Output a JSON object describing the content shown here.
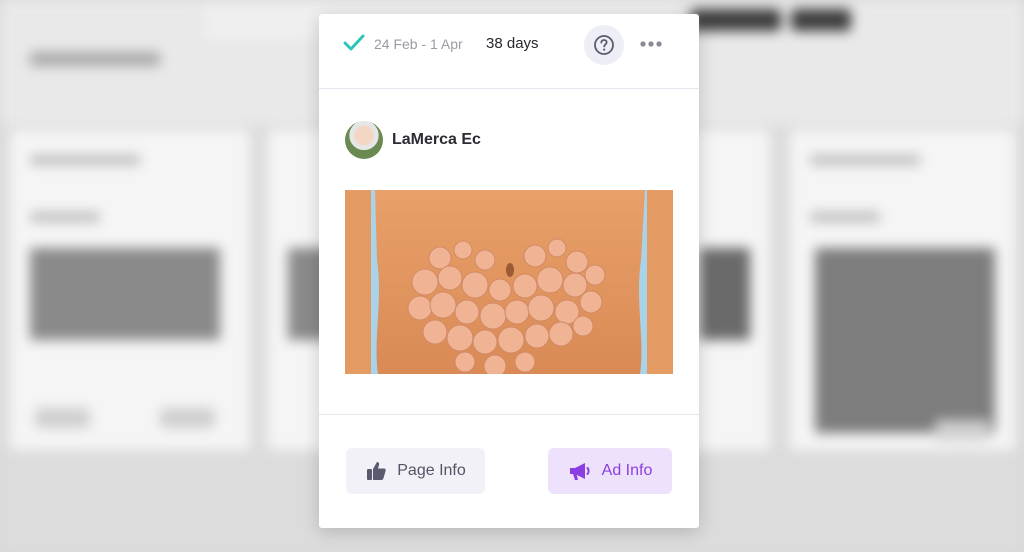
{
  "ad_card": {
    "date_range": "24 Feb - 1 Apr",
    "duration": "38 days",
    "help_icon": "question-circle-icon",
    "more_icon": "ellipsis-icon",
    "status_icon": "checkmark-icon",
    "advertiser_name": "LaMerca Ec",
    "page_info_label": "Page Info",
    "ad_info_label": "Ad Info",
    "page_info_icon": "thumbs-up-icon",
    "ad_info_icon": "megaphone-icon"
  },
  "colors": {
    "check": "#2ec4b6",
    "ad_info_text": "#8b3fe0",
    "ad_info_bg": "#ede1fb",
    "page_info_bg": "#f1f1f7"
  }
}
